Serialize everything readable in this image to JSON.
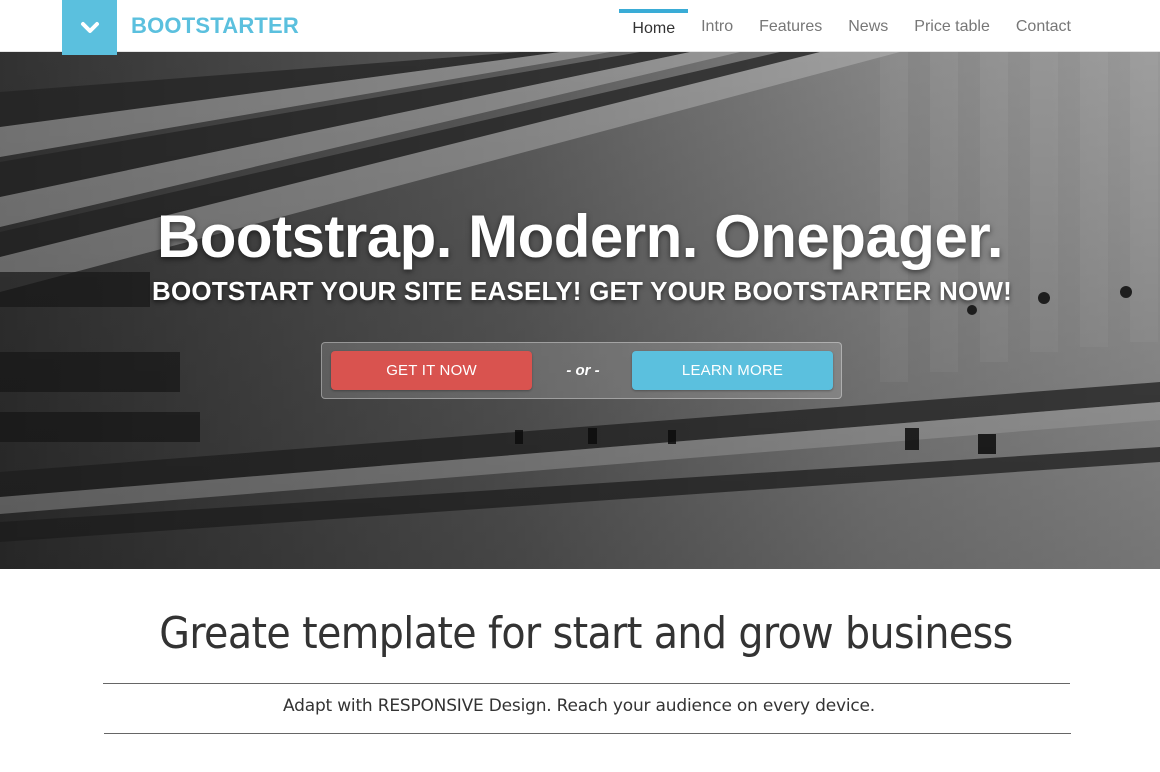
{
  "navbar": {
    "brand": "BOOTSTARTER",
    "logo_icon": "chevron-down-icon",
    "items": [
      {
        "label": "Home",
        "active": true
      },
      {
        "label": "Intro",
        "active": false
      },
      {
        "label": "Features",
        "active": false
      },
      {
        "label": "News",
        "active": false
      },
      {
        "label": "Price table",
        "active": false
      },
      {
        "label": "Contact",
        "active": false
      }
    ]
  },
  "hero": {
    "title": "Bootstrap. Modern. Onepager.",
    "subtitle": "BOOTSTART YOUR SITE EASELY! GET YOUR BOOTSTARTER NOW!",
    "primary_button": "GET IT NOW",
    "separator": "- or -",
    "secondary_button": "LEARN MORE"
  },
  "intro": {
    "heading": "Greate template for start and grow business",
    "text": "Adapt with RESPONSIVE Design. Reach your audience on every device."
  },
  "colors": {
    "accent": "#5bc0de",
    "danger": "#d9534f",
    "nav_active_bar": "#3aacd6"
  }
}
